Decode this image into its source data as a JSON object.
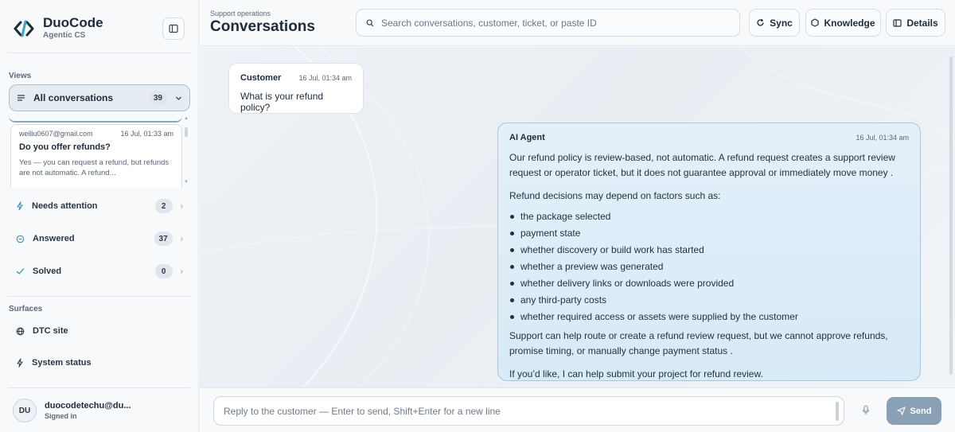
{
  "brand": {
    "name": "DuoCode",
    "subtitle": "Agentic CS"
  },
  "sidebar": {
    "views_label": "Views",
    "all_conversations": {
      "label": "All conversations",
      "count": "39"
    },
    "preview": {
      "email": "weiliu0607@gmail.com",
      "time": "16 Jul, 01:33 am",
      "title": "Do you offer refunds?",
      "snippet": "Yes — you can request a refund, but refunds are not automatic. A refund..."
    },
    "views": [
      {
        "label": "Needs attention",
        "count": "2",
        "icon": "lightning-icon"
      },
      {
        "label": "Answered",
        "count": "37",
        "icon": "chat-bubble-icon"
      },
      {
        "label": "Solved",
        "count": "0",
        "icon": "check-icon"
      }
    ],
    "surfaces_label": "Surfaces",
    "surfaces": [
      {
        "label": "DTC site",
        "icon": "globe-icon"
      },
      {
        "label": "System status",
        "icon": "lightning-icon"
      }
    ],
    "user": {
      "initials": "DU",
      "name": "duocodetechu@du...",
      "status": "Signed in"
    }
  },
  "header": {
    "crumb": "Support operations",
    "title": "Conversations",
    "search_placeholder": "Search conversations, customer, ticket, or paste ID",
    "sync_label": "Sync",
    "knowledge_label": "Knowledge",
    "details_label": "Details"
  },
  "messages": {
    "customer": {
      "role": "Customer",
      "time": "16 Jul, 01:34 am",
      "text": "What is your refund policy?"
    },
    "agent": {
      "role": "AI Agent",
      "time": "16 Jul, 01:34 am",
      "intro": "Our refund policy is review-based, not automatic. A refund request creates a support review request or operator ticket, but it does not guarantee approval or immediately move money .",
      "factors_intro": "Refund decisions may depend on factors such as:",
      "factors": [
        "the package selected",
        "payment state",
        "whether discovery or build work has started",
        "whether a preview was generated",
        "whether delivery links or downloads were provided",
        "any third-party costs",
        "whether required access or assets were supplied by the customer"
      ],
      "support": "Support can help route or create a refund review request, but we cannot approve refunds, promise timing, or manually change payment status .",
      "closing": "If you’d like, I can help submit your project for refund review."
    }
  },
  "composer": {
    "placeholder": "Reply to the customer — Enter to send, Shift+Enter for a new line",
    "send_label": "Send"
  },
  "colors": {
    "accent": "#1f2a3a",
    "agent_bubble": "#d7eaf8",
    "send_button": "#8aa0b4"
  }
}
